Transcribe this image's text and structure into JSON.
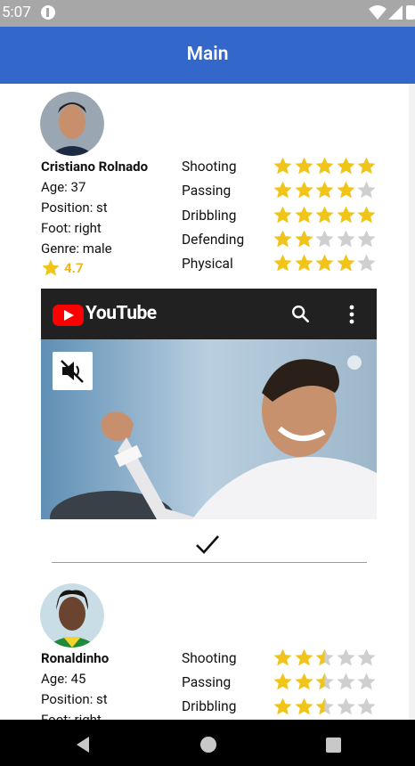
{
  "status_bar": {
    "time": "5:07"
  },
  "app_bar": {
    "title": "Main"
  },
  "skill_labels": [
    "Shooting",
    "Passing",
    "Dribbling",
    "Defending",
    "Physical"
  ],
  "players": [
    {
      "name": "Cristiano Rolnado",
      "age": "Age: 37",
      "position": "Position: st",
      "foot": "Foot: right",
      "genre": "Genre: male",
      "rating": "4.7",
      "skills": [
        5,
        4,
        5,
        2,
        4
      ],
      "video": {
        "brand": "YouTube"
      }
    },
    {
      "name": "Ronaldinho",
      "age": "Age: 45",
      "position": "Position: st",
      "foot": "Foot: right",
      "skills": [
        2.5,
        2.5,
        2.5
      ]
    }
  ],
  "colors": {
    "app_bar": "#3367c9",
    "star_filled": "#f0c419",
    "star_empty": "#cfcfcf",
    "rating_text": "#f0b51e"
  },
  "icons": [
    "sync-icon",
    "wifi-icon",
    "signal-icon",
    "battery-icon",
    "search-icon",
    "more-vert-icon",
    "mute-icon",
    "check-icon",
    "back-icon",
    "home-icon",
    "recents-icon"
  ]
}
